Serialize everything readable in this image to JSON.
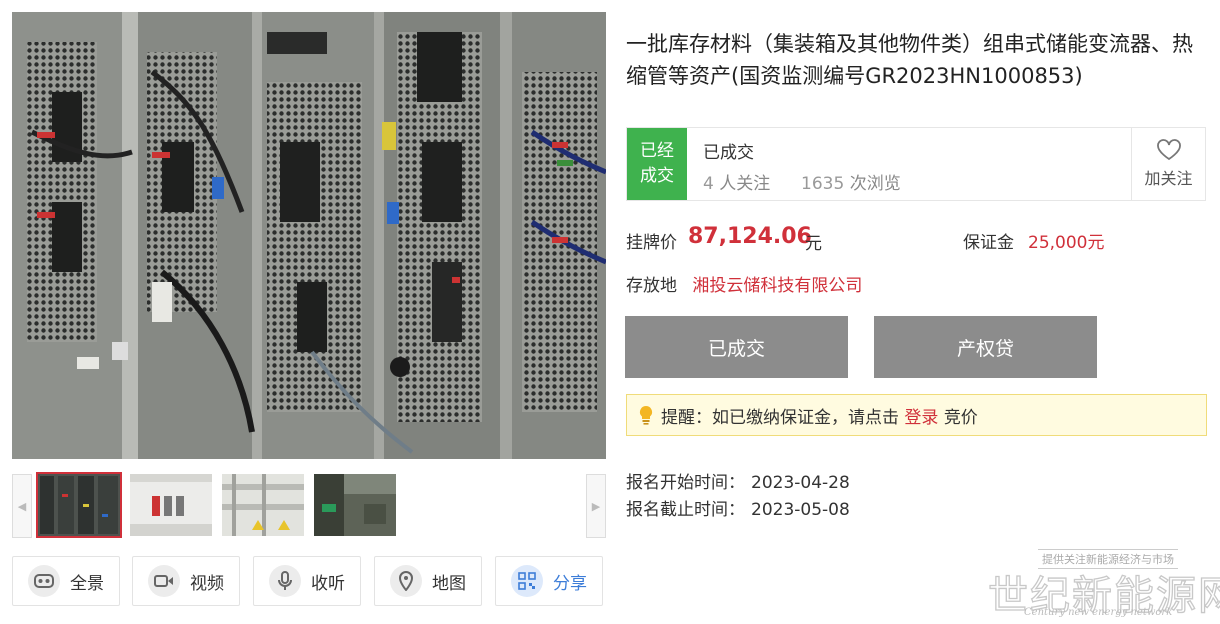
{
  "listing": {
    "title": "一批库存材料（集装箱及其他物件类）组串式储能变流器、热缩管等资产(国资监测编号GR2023HN1000853)",
    "status_badge": "已经成交",
    "status_text": "已成交",
    "followers_count": "4",
    "followers_label": "人关注",
    "views_count": "1635",
    "views_label": "次浏览",
    "follow_button": "加关注",
    "price_label": "挂牌价",
    "price_value": "87,124.06",
    "price_unit": "元",
    "deposit_label": "保证金",
    "deposit_value": "25,000元",
    "location_label": "存放地",
    "location_value": "湘投云储科技有限公司"
  },
  "actions": {
    "deal_button": "已成交",
    "loan_button": "产权贷"
  },
  "tip": {
    "prefix": "提醒：如已缴纳保证金，请点击",
    "link": "登录",
    "suffix": "竞价"
  },
  "dates": {
    "start_label": "报名开始时间：",
    "start_value": "2023-04-28",
    "end_label": "报名截止时间：",
    "end_value": "2023-05-08"
  },
  "gallery": {
    "prev_arrow": "◀",
    "next_arrow": "▶",
    "thumb_count": 4
  },
  "tools": [
    {
      "label": "全景",
      "icon": "vr-icon"
    },
    {
      "label": "视频",
      "icon": "video-icon"
    },
    {
      "label": "收听",
      "icon": "microphone-icon"
    },
    {
      "label": "地图",
      "icon": "map-pin-icon"
    },
    {
      "label": "分享",
      "icon": "qr-code-icon"
    }
  ],
  "watermark": {
    "top": "提供关注新能源经济与市场",
    "main": "世纪新能源网",
    "sub": "Century new energy network"
  },
  "colors": {
    "accent_red": "#d0303a",
    "status_green": "#3fb24e",
    "button_gray": "#8c8c8c",
    "share_blue": "#3d7dd8"
  }
}
